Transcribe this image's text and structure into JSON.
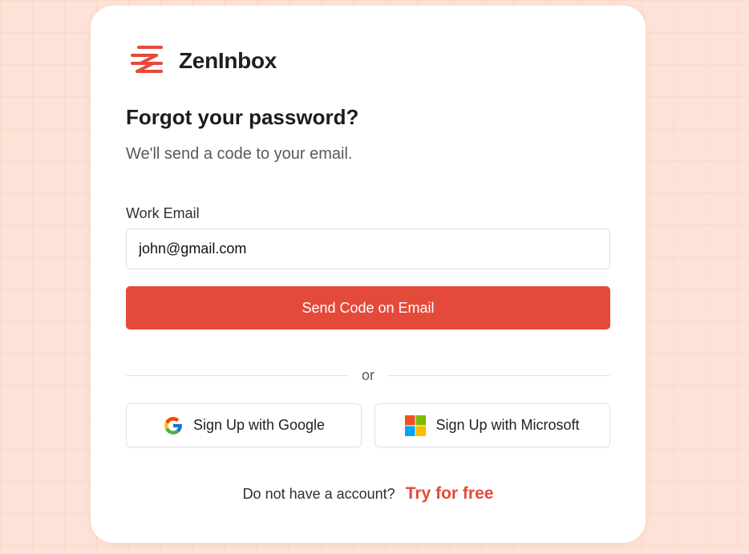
{
  "brand": {
    "name": "ZenInbox",
    "logo_icon": "zeninbox-logo-icon",
    "accent_color": "#e44a3a"
  },
  "form": {
    "title": "Forgot your password?",
    "subtitle": "We'll send a code to your email.",
    "email_label": "Work Email",
    "email_value": "john@gmail.com",
    "submit_label": "Send Code on Email"
  },
  "divider": {
    "text": "or"
  },
  "social": {
    "google_label": "Sign Up with Google",
    "google_icon": "google-icon",
    "microsoft_label": "Sign Up with Microsoft",
    "microsoft_icon": "microsoft-icon"
  },
  "footer": {
    "prompt": "Do not have a account?",
    "link_label": "Try for free"
  }
}
